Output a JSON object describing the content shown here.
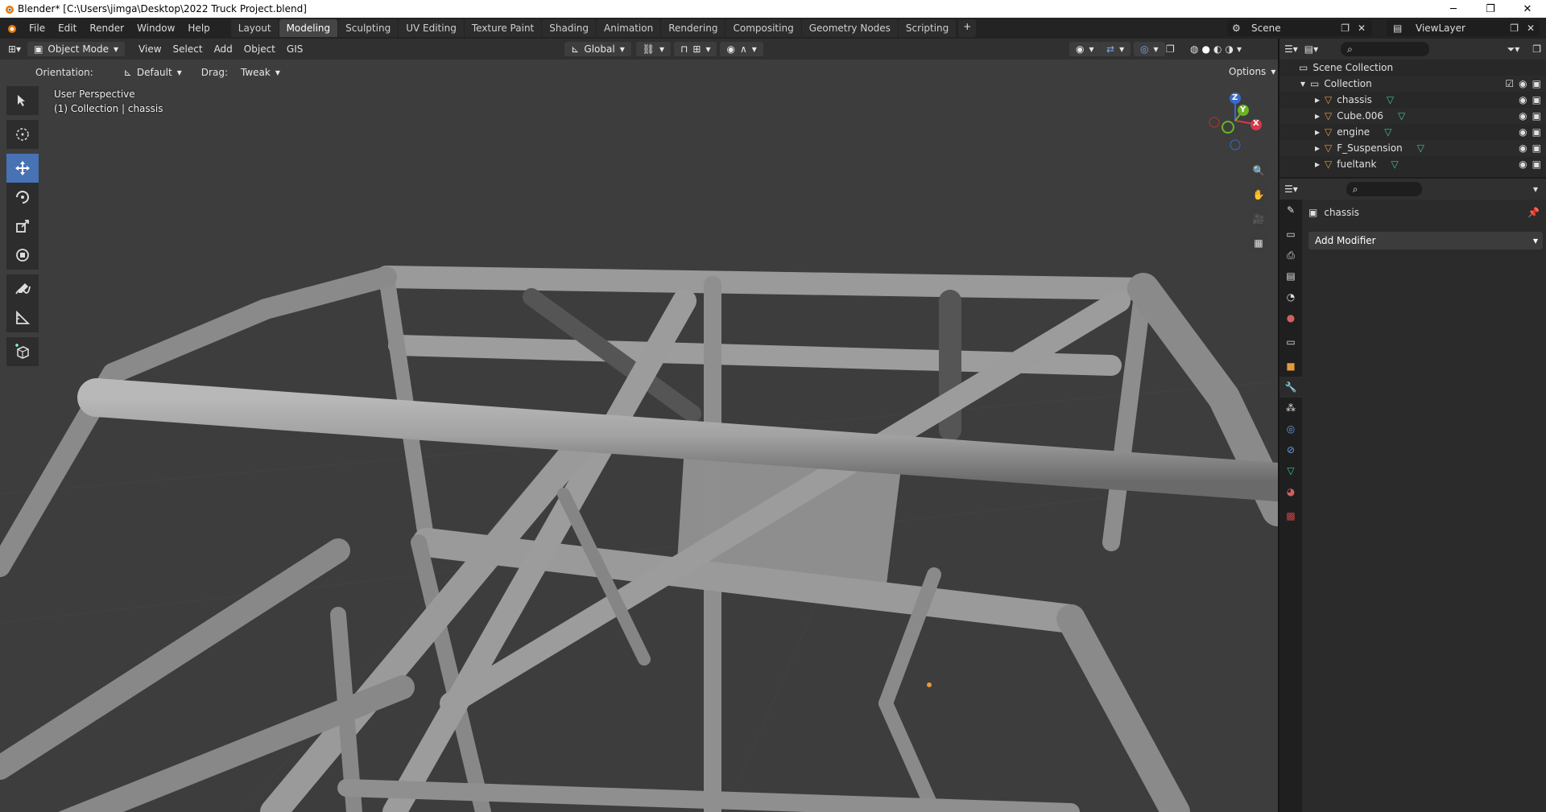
{
  "window": {
    "title": "Blender* [C:\\Users\\jimga\\Desktop\\2022 Truck Project.blend]",
    "minimize": "─",
    "maximize": "❐",
    "close": "✕"
  },
  "menu": [
    "File",
    "Edit",
    "Render",
    "Window",
    "Help"
  ],
  "workspaces": [
    "Layout",
    "Modeling",
    "Sculpting",
    "UV Editing",
    "Texture Paint",
    "Shading",
    "Animation",
    "Rendering",
    "Compositing",
    "Geometry Nodes",
    "Scripting"
  ],
  "active_workspace": "Modeling",
  "add_workspace": "+",
  "scene": {
    "label": "Scene"
  },
  "view_layer": {
    "label": "ViewLayer"
  },
  "viewport_header": {
    "mode": "Object Mode",
    "menus": [
      "View",
      "Select",
      "Add",
      "Object",
      "GIS"
    ],
    "transform_orientation": "Global"
  },
  "tool_settings": {
    "orientation_label": "Orientation:",
    "orientation_value": "Default",
    "drag_label": "Drag:",
    "drag_value": "Tweak",
    "options": "Options"
  },
  "viewport_overlay": {
    "view_name": "User Perspective",
    "context": "(1) Collection | chassis"
  },
  "gizmo_axes": {
    "x": "X",
    "y": "Y",
    "z": "Z"
  },
  "outliner": {
    "root": "Scene Collection",
    "collection": "Collection",
    "items": [
      "chassis",
      "Cube.006",
      "engine",
      "F_Suspension",
      "fueltank"
    ]
  },
  "properties": {
    "object_name": "chassis",
    "add_modifier": "Add Modifier"
  },
  "colors": {
    "active_blue": "#4772b3",
    "viewport_bg": "#3d3d3d",
    "object_orange": "#e59a3a",
    "mesh_green": "#3ec48c"
  }
}
